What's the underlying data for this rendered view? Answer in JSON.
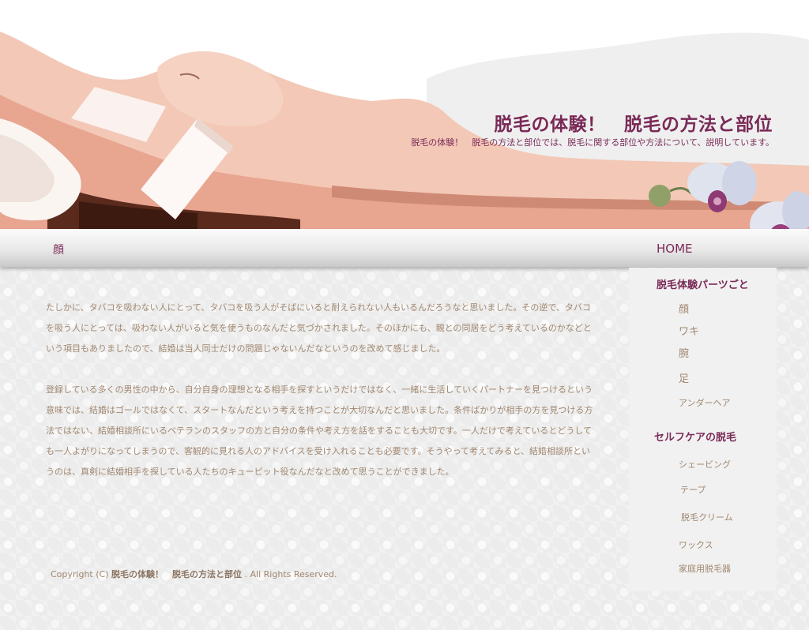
{
  "header": {
    "title": "脱毛の体験！　脱毛の方法と部位",
    "description": "脱毛の体験！　脱毛の方法と部位では、脱毛に関する部位や方法について、説明しています。"
  },
  "nav": {
    "left_label": "顔",
    "home_label": "HOME"
  },
  "main": {
    "paragraphs": [
      "たしかに、タバコを吸わない人にとって、タバコを吸う人がそばにいると耐えられない人もいるんだろうなと思いました。その逆で、タバコを吸う人にとっては、吸わない人がいると気を使うものなんだと気づかされました。そのほかにも、親との同居をどう考えているのかなどという項目もありましたので、結婚は当人同士だけの問題じゃないんだなというのを改めて感じました。",
      "登録している多くの男性の中から、自分自身の理想となる相手を探すというだけではなく、一緒に生活していくパートナーを見つけるという意味では、結婚はゴールではなくて、スタートなんだという考えを持つことが大切なんだと思いました。条件ばかりが相手の方を見つける方法ではない、結婚相談所にいるベテランのスタッフの方と自分の条件や考え方を話をすることも大切です。一人だけで考えているとどうしても一人よがりになってしまうので、客観的に見れる人のアドバイスを受け入れることも必要です。そうやって考えてみると、結婚相談所というのは、真剣に結婚相手を探している人たちのキューピット役なんだなと改めて思うことができました。"
    ]
  },
  "footer": {
    "prefix": "Copyright (C)",
    "site_name": "脱毛の体験！　脱毛の方法と部位",
    "suffix": ". All Rights Reserved."
  },
  "sidebar": {
    "sections": [
      {
        "heading": "脱毛体験パーツごと",
        "items": [
          "顔",
          "ワキ",
          "腕",
          "足",
          "アンダーヘア"
        ]
      },
      {
        "heading": "セルフケアの脱毛",
        "items": [
          "シェービング",
          "テープ",
          "脱毛クリーム",
          "ワックス",
          "家庭用脱毛器"
        ]
      }
    ]
  },
  "colors": {
    "accent": "#7a2a57",
    "body_text": "#a08770",
    "sidebar_bg": "#f1f1f1"
  }
}
